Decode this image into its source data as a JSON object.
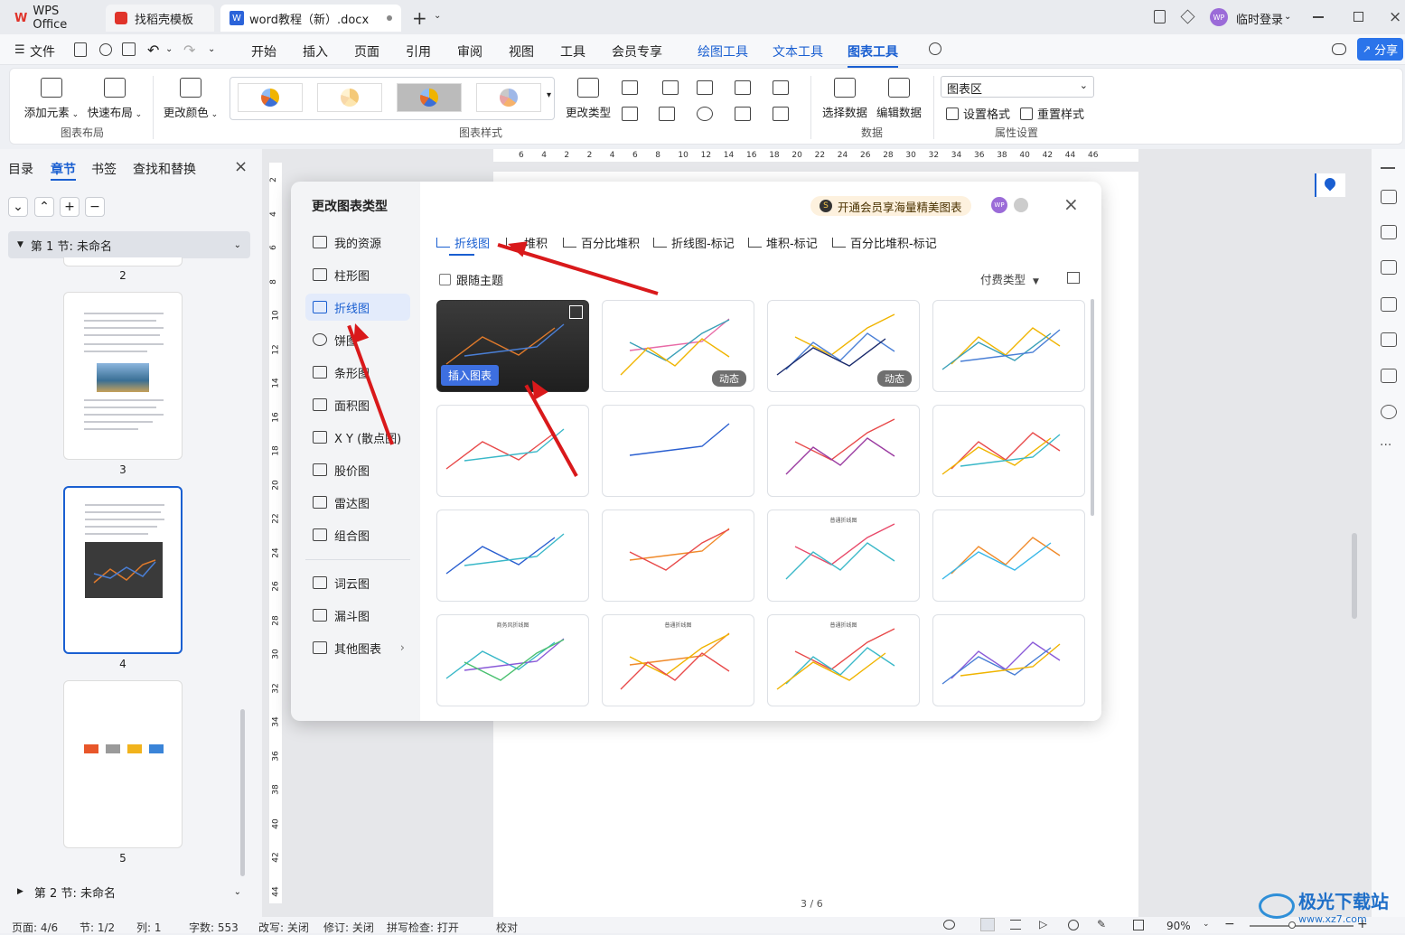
{
  "titlebar": {
    "tabs": [
      {
        "label": "WPS Office"
      },
      {
        "label": "找稻壳模板"
      },
      {
        "label": "word教程（新）.docx"
      }
    ],
    "login_label": "临时登录",
    "avatar_text": "WP"
  },
  "menubar": {
    "file_label": "文件",
    "items": [
      "开始",
      "插入",
      "页面",
      "引用",
      "审阅",
      "视图",
      "工具",
      "会员专享",
      "绘图工具",
      "文本工具",
      "图表工具"
    ],
    "share_label": "分享"
  },
  "ribbon": {
    "add_element": "添加元素",
    "quick_layout": "快速布局",
    "change_color": "更改颜色",
    "change_type": "更改类型",
    "select_data": "选择数据",
    "edit_data": "编辑数据",
    "chart_area_select": "图表区",
    "set_format": "设置格式",
    "reset_style": "重置样式",
    "groups": {
      "layout": "图表布局",
      "style": "图表样式",
      "data": "数据",
      "props": "属性设置"
    }
  },
  "leftpanel": {
    "tabs": [
      "目录",
      "章节",
      "书签",
      "查找和替换"
    ],
    "section1": "第 1 节: 未命名",
    "section2": "第 2 节: 未命名",
    "page_numbers": [
      "2",
      "3",
      "4",
      "5"
    ]
  },
  "ruler_top_numbers": [
    "6",
    "4",
    "2",
    "2",
    "4",
    "6",
    "8",
    "10",
    "12",
    "14",
    "16",
    "18",
    "20",
    "22",
    "24",
    "26",
    "28",
    "30",
    "32",
    "34",
    "36",
    "38",
    "40",
    "42",
    "44",
    "46"
  ],
  "ruler_left_numbers": [
    "2",
    "4",
    "6",
    "8",
    "10",
    "12",
    "14",
    "16",
    "18",
    "20",
    "22",
    "24",
    "26",
    "28",
    "30",
    "32",
    "34",
    "36",
    "38",
    "40",
    "42",
    "44"
  ],
  "page_counter": "3 / 6",
  "dialog": {
    "title": "更改图表类型",
    "vip_promo": "开通会员享海量精美图表",
    "categories": [
      "我的资源",
      "柱形图",
      "折线图",
      "饼图",
      "条形图",
      "面积图",
      "X Y (散点图)",
      "股价图",
      "雷达图",
      "组合图",
      "词云图",
      "漏斗图",
      "其他图表"
    ],
    "subtabs": [
      "折线图",
      "堆积",
      "百分比堆积",
      "折线图-标记",
      "堆积-标记",
      "百分比堆积-标记"
    ],
    "follow_theme": "跟随主题",
    "pay_type": "付费类型",
    "insert_label": "插入图表",
    "dynamic_label": "动态",
    "card_titles": [
      "",
      "",
      "",
      "",
      "",
      "",
      "",
      "",
      "",
      "",
      "普通折线图",
      "",
      "商务风折线图",
      "普通折线图",
      "普通折线图",
      ""
    ]
  },
  "statusbar": {
    "page": "页面: 4/6",
    "section": "节: 1/2",
    "col": "列: 1",
    "words": "字数: 553",
    "rewrite": "改写: 关闭",
    "revise": "修订: 关闭",
    "spell": "拼写检查: 打开",
    "proof": "校对",
    "zoom": "90%"
  },
  "watermark": "极光下载站",
  "watermark_url": "www.xz7.com"
}
